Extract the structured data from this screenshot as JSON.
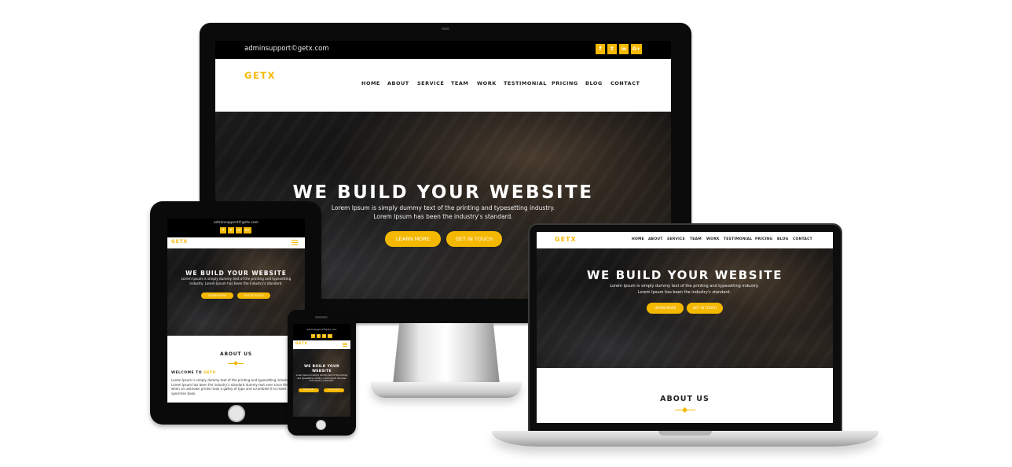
{
  "site": {
    "email": "adminsupport©getx.com",
    "logo": "GETX",
    "nav": [
      "HOME",
      "ABOUT",
      "SERVICE",
      "TEAM",
      "WORK",
      "TESTIMONIAL",
      "PRICING",
      "BLOG",
      "CONTACT"
    ],
    "social": [
      "f",
      "t",
      "in",
      "G+"
    ],
    "hero_title": "WE BUILD YOUR WEBSITE",
    "hero_sub": "Lorem Ipsum is simply dummy text of the printing and typesetting industry. Lorem Ipsum has been the industry's standard.",
    "btn_learn": "LEARN MORE",
    "btn_touch": "GET IN TOUCH",
    "about_title": "ABOUT US",
    "welcome_prefix": "WELCOME TO",
    "welcome_brand": "GETX",
    "about_body": "Lorem Ipsum is simply dummy text of the printing and typesetting industry. Lorem Ipsum has been the industry's standard dummy text ever since the 1500s, when an unknown printer took a galley of type and scrambled it to make a type specimen book.",
    "menu_icon": "hamburger-menu-icon"
  },
  "colors": {
    "accent": "#f5b800",
    "dark": "#0b0b0b",
    "white": "#ffffff"
  }
}
